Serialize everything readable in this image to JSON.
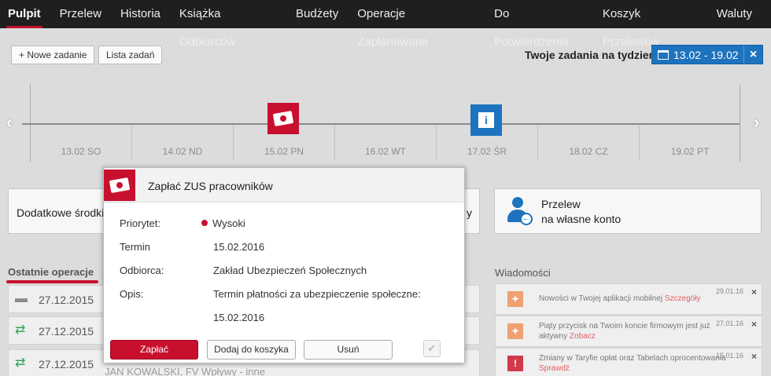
{
  "nav": {
    "items": [
      "Pulpit",
      "Przelew",
      "Historia",
      "Książka Odbiorców",
      "Budżety",
      "Operacje Zaplanowane",
      "Do Potwierdzenia",
      "Koszyk Przelewów",
      "Waluty"
    ],
    "active": "Pulpit"
  },
  "toolbar": {
    "new_task": "+ Nowe zadanie",
    "task_list": "Lista zadań",
    "week_label": "Twoje zadania na tydzień",
    "week_range": "13.02 - 19.02",
    "close": "×"
  },
  "timeline": {
    "days": [
      "13.02 SO",
      "14.02 ND",
      "15.02 PN",
      "16.02 WT",
      "17.02 ŚR",
      "18.02 CZ",
      "19.02 PT"
    ],
    "prev": "‹",
    "next": "›",
    "event_info_icon": "i"
  },
  "cards": {
    "extra_funds": "Dodatkowe środki",
    "right_partial": "y",
    "transfer_title": "Przelew",
    "transfer_subtitle": "na własne konto"
  },
  "sections": {
    "recent": "Ostatnie operacje",
    "messages": "Wiadomości"
  },
  "operations": [
    {
      "date": "27.12.2015",
      "icon": "folder-icon",
      "extra": ""
    },
    {
      "date": "27.12.2015",
      "icon": "transfer-arrows-icon",
      "extra": ""
    },
    {
      "date": "27.12.2015",
      "icon": "transfer-arrows-icon",
      "extra": "JAN KOWALSKI, FV      Wpływy - inne"
    }
  ],
  "messages": [
    {
      "text": "Nowości w Twojej aplikacji mobilnej",
      "link": "Szczegóły",
      "date": "29.01.16",
      "icon": "lightbulb-icon",
      "color": "#f0a070"
    },
    {
      "text": "Piąty przycisk na Twoim koncie firmowym jest już aktywny",
      "link": "Zobacz",
      "date": "27.01.16",
      "icon": "lightbulb-icon",
      "color": "#f0a070"
    },
    {
      "text": "Zmiany w Taryfie opłat oraz Tabelach oprocentowania",
      "link": "Sprawdź",
      "date": "15.01.16",
      "icon": "alert-icon",
      "color": "#d03a4a"
    }
  ],
  "popup": {
    "title": "Zapłać ZUS pracowników",
    "priority_label": "Priorytet:",
    "priority_value": "Wysoki",
    "term_label": "Termin",
    "term_value": "15.02.2016",
    "recipient_label": "Odbiorca:",
    "recipient_value": "Zakład Ubezpieczeń Społecznych",
    "desc_label": "Opis:",
    "desc_line1": "Termin płatności za ubezpieczenie społeczne:",
    "desc_line2": "15.02.2016",
    "pay": "Zapłać",
    "add_cart": "Dodaj do koszyka",
    "delete": "Usuń",
    "check": "✔"
  },
  "colors": {
    "accent": "#c8102e",
    "blue": "#1e73be"
  }
}
